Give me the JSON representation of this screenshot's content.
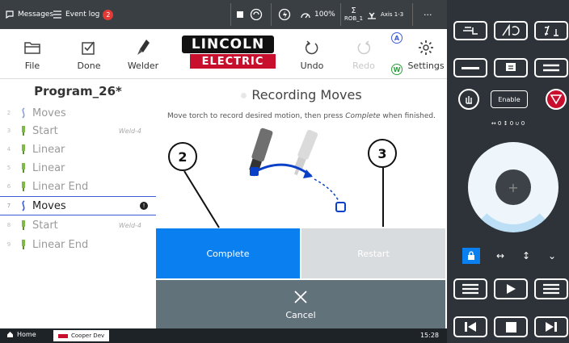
{
  "statusbar": {
    "messages": "Messages",
    "event_log": "Event log",
    "event_count": "2",
    "speed": "100%",
    "robot": "ROB_1",
    "axis": "Axis 1-3",
    "more": "···"
  },
  "toolbar": {
    "file": "File",
    "done": "Done",
    "welder": "Welder",
    "undo": "Undo",
    "redo": "Redo",
    "settings": "Settings"
  },
  "logo": {
    "line1": "LINCOLN",
    "line2": "ELECTRIC"
  },
  "program": {
    "title": "Program_26*",
    "rows": [
      {
        "num": "2",
        "label": "Moves",
        "icon": "moves-icon",
        "weld": ""
      },
      {
        "num": "3",
        "label": "Start",
        "icon": "torch-icon",
        "weld": "Weld-4"
      },
      {
        "num": "4",
        "label": "Linear",
        "icon": "torch-icon",
        "weld": ""
      },
      {
        "num": "5",
        "label": "Linear",
        "icon": "torch-icon",
        "weld": ""
      },
      {
        "num": "6",
        "label": "Linear End",
        "icon": "torch-icon",
        "weld": ""
      },
      {
        "num": "7",
        "label": "Moves",
        "icon": "moves-icon",
        "weld": ""
      },
      {
        "num": "8",
        "label": "Start",
        "icon": "torch-icon",
        "weld": "Weld-4"
      },
      {
        "num": "9",
        "label": "Linear End",
        "icon": "torch-icon",
        "weld": ""
      }
    ]
  },
  "recording": {
    "title": "Recording Moves",
    "message_pre": "Move torch to record desired motion, then press ",
    "message_em": "Complete",
    "message_post": " when finished."
  },
  "actions": {
    "complete": "Complete",
    "restart": "Restart",
    "cancel": "Cancel"
  },
  "callouts": {
    "one": "2",
    "two": "3"
  },
  "taskbar": {
    "home": "Home",
    "device": "Cooper Dev",
    "time": "15:28"
  },
  "pendant": {
    "enable": "Enable",
    "readout": "↔ 0  ↕ 0  ∪ 0"
  },
  "colors": {
    "accent": "#0a80f0",
    "brand": "#c8102e",
    "selected": "#3b5bd6",
    "torch_green": "#7fb94a",
    "jog_ring": "#bcdff5"
  }
}
